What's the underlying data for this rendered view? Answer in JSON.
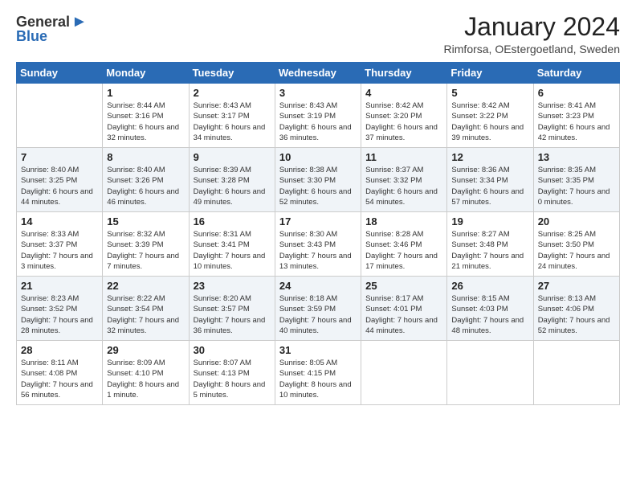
{
  "logo": {
    "general": "General",
    "blue": "Blue",
    "bird_unicode": "▲"
  },
  "header": {
    "month_title": "January 2024",
    "location": "Rimforsa, OEstergoetland, Sweden"
  },
  "weekdays": [
    "Sunday",
    "Monday",
    "Tuesday",
    "Wednesday",
    "Thursday",
    "Friday",
    "Saturday"
  ],
  "weeks": [
    {
      "shaded": false,
      "days": [
        {
          "num": "",
          "sunrise": "",
          "sunset": "",
          "daylight": ""
        },
        {
          "num": "1",
          "sunrise": "Sunrise: 8:44 AM",
          "sunset": "Sunset: 3:16 PM",
          "daylight": "Daylight: 6 hours and 32 minutes."
        },
        {
          "num": "2",
          "sunrise": "Sunrise: 8:43 AM",
          "sunset": "Sunset: 3:17 PM",
          "daylight": "Daylight: 6 hours and 34 minutes."
        },
        {
          "num": "3",
          "sunrise": "Sunrise: 8:43 AM",
          "sunset": "Sunset: 3:19 PM",
          "daylight": "Daylight: 6 hours and 36 minutes."
        },
        {
          "num": "4",
          "sunrise": "Sunrise: 8:42 AM",
          "sunset": "Sunset: 3:20 PM",
          "daylight": "Daylight: 6 hours and 37 minutes."
        },
        {
          "num": "5",
          "sunrise": "Sunrise: 8:42 AM",
          "sunset": "Sunset: 3:22 PM",
          "daylight": "Daylight: 6 hours and 39 minutes."
        },
        {
          "num": "6",
          "sunrise": "Sunrise: 8:41 AM",
          "sunset": "Sunset: 3:23 PM",
          "daylight": "Daylight: 6 hours and 42 minutes."
        }
      ]
    },
    {
      "shaded": true,
      "days": [
        {
          "num": "7",
          "sunrise": "Sunrise: 8:40 AM",
          "sunset": "Sunset: 3:25 PM",
          "daylight": "Daylight: 6 hours and 44 minutes."
        },
        {
          "num": "8",
          "sunrise": "Sunrise: 8:40 AM",
          "sunset": "Sunset: 3:26 PM",
          "daylight": "Daylight: 6 hours and 46 minutes."
        },
        {
          "num": "9",
          "sunrise": "Sunrise: 8:39 AM",
          "sunset": "Sunset: 3:28 PM",
          "daylight": "Daylight: 6 hours and 49 minutes."
        },
        {
          "num": "10",
          "sunrise": "Sunrise: 8:38 AM",
          "sunset": "Sunset: 3:30 PM",
          "daylight": "Daylight: 6 hours and 52 minutes."
        },
        {
          "num": "11",
          "sunrise": "Sunrise: 8:37 AM",
          "sunset": "Sunset: 3:32 PM",
          "daylight": "Daylight: 6 hours and 54 minutes."
        },
        {
          "num": "12",
          "sunrise": "Sunrise: 8:36 AM",
          "sunset": "Sunset: 3:34 PM",
          "daylight": "Daylight: 6 hours and 57 minutes."
        },
        {
          "num": "13",
          "sunrise": "Sunrise: 8:35 AM",
          "sunset": "Sunset: 3:35 PM",
          "daylight": "Daylight: 7 hours and 0 minutes."
        }
      ]
    },
    {
      "shaded": false,
      "days": [
        {
          "num": "14",
          "sunrise": "Sunrise: 8:33 AM",
          "sunset": "Sunset: 3:37 PM",
          "daylight": "Daylight: 7 hours and 3 minutes."
        },
        {
          "num": "15",
          "sunrise": "Sunrise: 8:32 AM",
          "sunset": "Sunset: 3:39 PM",
          "daylight": "Daylight: 7 hours and 7 minutes."
        },
        {
          "num": "16",
          "sunrise": "Sunrise: 8:31 AM",
          "sunset": "Sunset: 3:41 PM",
          "daylight": "Daylight: 7 hours and 10 minutes."
        },
        {
          "num": "17",
          "sunrise": "Sunrise: 8:30 AM",
          "sunset": "Sunset: 3:43 PM",
          "daylight": "Daylight: 7 hours and 13 minutes."
        },
        {
          "num": "18",
          "sunrise": "Sunrise: 8:28 AM",
          "sunset": "Sunset: 3:46 PM",
          "daylight": "Daylight: 7 hours and 17 minutes."
        },
        {
          "num": "19",
          "sunrise": "Sunrise: 8:27 AM",
          "sunset": "Sunset: 3:48 PM",
          "daylight": "Daylight: 7 hours and 21 minutes."
        },
        {
          "num": "20",
          "sunrise": "Sunrise: 8:25 AM",
          "sunset": "Sunset: 3:50 PM",
          "daylight": "Daylight: 7 hours and 24 minutes."
        }
      ]
    },
    {
      "shaded": true,
      "days": [
        {
          "num": "21",
          "sunrise": "Sunrise: 8:23 AM",
          "sunset": "Sunset: 3:52 PM",
          "daylight": "Daylight: 7 hours and 28 minutes."
        },
        {
          "num": "22",
          "sunrise": "Sunrise: 8:22 AM",
          "sunset": "Sunset: 3:54 PM",
          "daylight": "Daylight: 7 hours and 32 minutes."
        },
        {
          "num": "23",
          "sunrise": "Sunrise: 8:20 AM",
          "sunset": "Sunset: 3:57 PM",
          "daylight": "Daylight: 7 hours and 36 minutes."
        },
        {
          "num": "24",
          "sunrise": "Sunrise: 8:18 AM",
          "sunset": "Sunset: 3:59 PM",
          "daylight": "Daylight: 7 hours and 40 minutes."
        },
        {
          "num": "25",
          "sunrise": "Sunrise: 8:17 AM",
          "sunset": "Sunset: 4:01 PM",
          "daylight": "Daylight: 7 hours and 44 minutes."
        },
        {
          "num": "26",
          "sunrise": "Sunrise: 8:15 AM",
          "sunset": "Sunset: 4:03 PM",
          "daylight": "Daylight: 7 hours and 48 minutes."
        },
        {
          "num": "27",
          "sunrise": "Sunrise: 8:13 AM",
          "sunset": "Sunset: 4:06 PM",
          "daylight": "Daylight: 7 hours and 52 minutes."
        }
      ]
    },
    {
      "shaded": false,
      "days": [
        {
          "num": "28",
          "sunrise": "Sunrise: 8:11 AM",
          "sunset": "Sunset: 4:08 PM",
          "daylight": "Daylight: 7 hours and 56 minutes."
        },
        {
          "num": "29",
          "sunrise": "Sunrise: 8:09 AM",
          "sunset": "Sunset: 4:10 PM",
          "daylight": "Daylight: 8 hours and 1 minute."
        },
        {
          "num": "30",
          "sunrise": "Sunrise: 8:07 AM",
          "sunset": "Sunset: 4:13 PM",
          "daylight": "Daylight: 8 hours and 5 minutes."
        },
        {
          "num": "31",
          "sunrise": "Sunrise: 8:05 AM",
          "sunset": "Sunset: 4:15 PM",
          "daylight": "Daylight: 8 hours and 10 minutes."
        },
        {
          "num": "",
          "sunrise": "",
          "sunset": "",
          "daylight": ""
        },
        {
          "num": "",
          "sunrise": "",
          "sunset": "",
          "daylight": ""
        },
        {
          "num": "",
          "sunrise": "",
          "sunset": "",
          "daylight": ""
        }
      ]
    }
  ]
}
